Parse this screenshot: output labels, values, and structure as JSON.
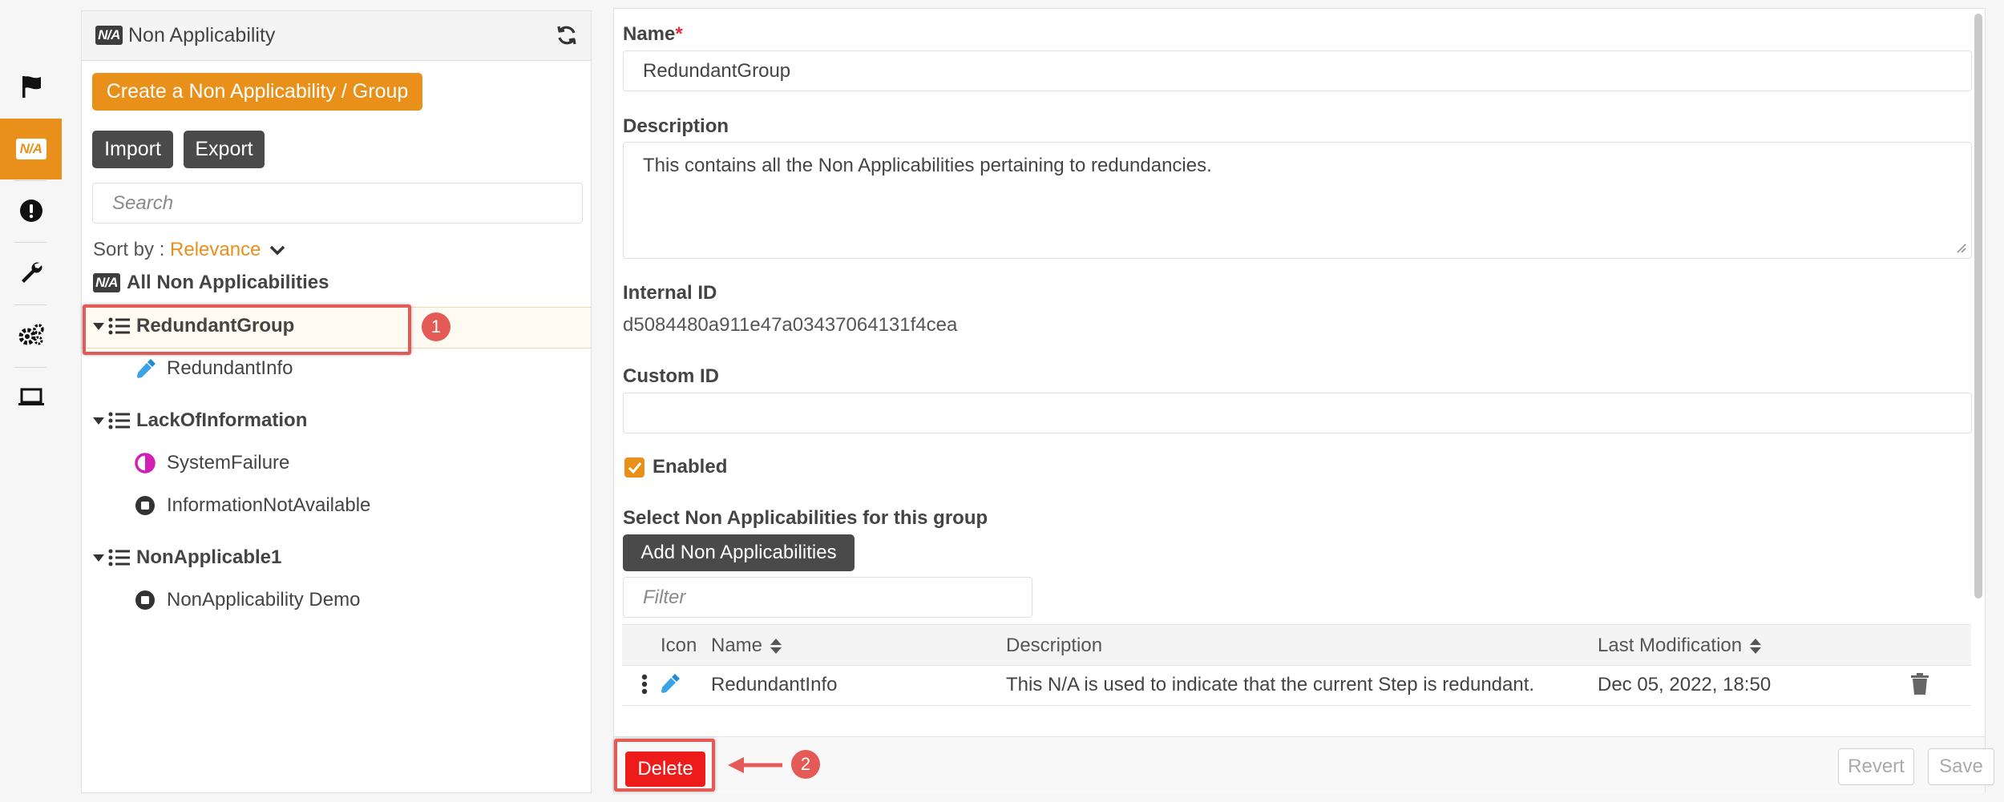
{
  "sidebar": {
    "icons": [
      "flag-icon",
      "non-applicability-icon",
      "alert-icon",
      "wrench-icon",
      "gears-icon",
      "laptop-icon"
    ],
    "active_icon_text": "N/A",
    "accent": "#e8901a"
  },
  "left_panel": {
    "badge": "N/A",
    "title": "Non Applicability",
    "create_button": "Create a Non Applicability / Group",
    "import_button": "Import",
    "export_button": "Export",
    "search_placeholder": "Search",
    "sort_label": "Sort by :",
    "sort_value": "Relevance",
    "all_label": "All Non Applicabilities",
    "tree": [
      {
        "group": "RedundantGroup",
        "items": [
          "RedundantInfo"
        ]
      },
      {
        "group": "LackOfInformation",
        "items": [
          "SystemFailure",
          "InformationNotAvailable"
        ]
      },
      {
        "group": "NonApplicable1",
        "items": [
          "NonApplicability Demo"
        ]
      }
    ]
  },
  "annotations": {
    "step1": "1",
    "step2": "2",
    "color": "#e35a57"
  },
  "form": {
    "name_label": "Name",
    "required_mark": "*",
    "name_value": "RedundantGroup",
    "description_label": "Description",
    "description_value": "This contains all the Non Applicabilities pertaining to redundancies.",
    "internal_id_label": "Internal ID",
    "internal_id_value": "d5084480a911e47a03437064131f4cea",
    "custom_id_label": "Custom ID",
    "custom_id_value": "",
    "enabled_label": "Enabled",
    "enabled": true,
    "select_label": "Select Non Applicabilities for this group",
    "add_button": "Add Non Applicabilities",
    "filter_placeholder": "Filter"
  },
  "table": {
    "headers": {
      "icon": "Icon",
      "name": "Name",
      "description": "Description",
      "last_modification": "Last Modification"
    },
    "rows": [
      {
        "name": "RedundantInfo",
        "description": "This N/A is used to indicate that the current Step is redundant.",
        "last_modification": "Dec 05, 2022, 18:50"
      }
    ]
  },
  "footer": {
    "delete_button": "Delete",
    "revert_button": "Revert",
    "save_button": "Save",
    "delete_color": "#ee1b1b"
  }
}
